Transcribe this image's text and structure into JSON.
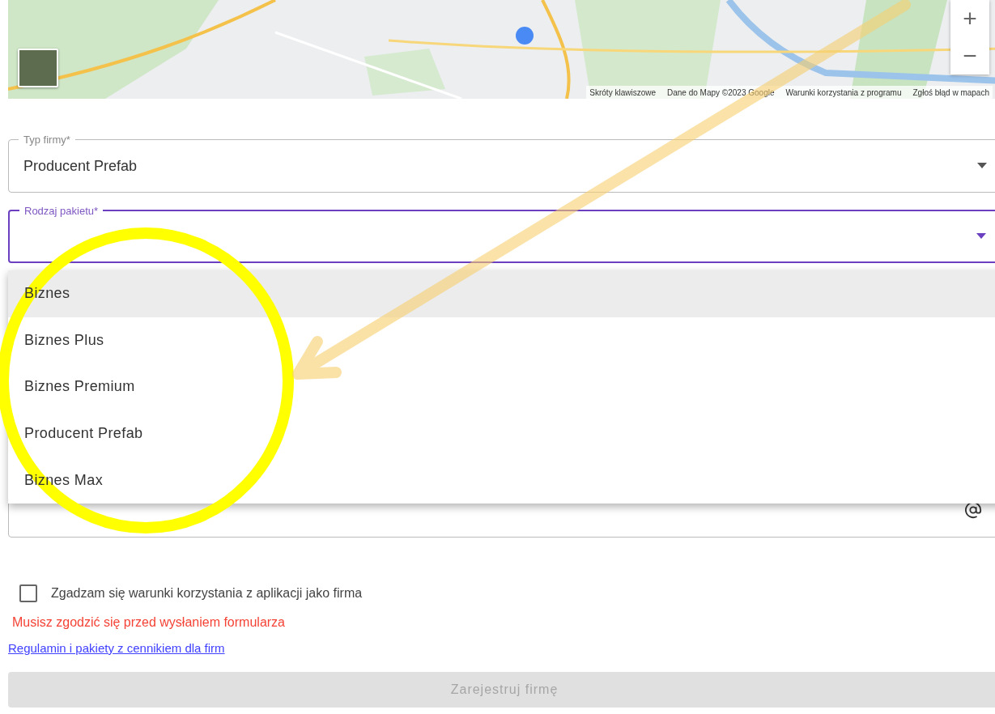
{
  "map": {
    "zoom_controls": [
      "+",
      "−"
    ],
    "attribution": [
      "Skróty klawiszowe",
      "Dane do Mapy ©2023 Google",
      "Warunki korzystania z programu",
      "Zgłoś błąd w mapach"
    ]
  },
  "fields": [
    {
      "label": "Typ firmy*",
      "value": "Producent Prefab",
      "focused": false
    },
    {
      "label": "Rodzaj pakietu*",
      "focused": true
    }
  ],
  "menu": {
    "items": [
      {
        "label": "Biznes",
        "selected": true
      },
      {
        "label": "Biznes Plus",
        "selected": false
      },
      {
        "label": "Biznes Premium",
        "selected": false
      },
      {
        "label": "Producent Prefab",
        "selected": false
      },
      {
        "label": "Biznes Max",
        "selected": false
      }
    ]
  },
  "consent": {
    "label": "Zgadzam się warunki korzystania z aplikacji jako firma",
    "checked": false
  },
  "error": "Musisz zgodzić się przed wysłaniem formularza",
  "link": "Regulamin i pakiety z cennikiem dla firm",
  "submit": {
    "label": "Zarejestruj firmę",
    "disabled": true
  },
  "annotations": [
    {
      "kind": "circle",
      "color": "#ffff00"
    },
    {
      "kind": "arrow",
      "color": "#f7cf6e"
    }
  ]
}
